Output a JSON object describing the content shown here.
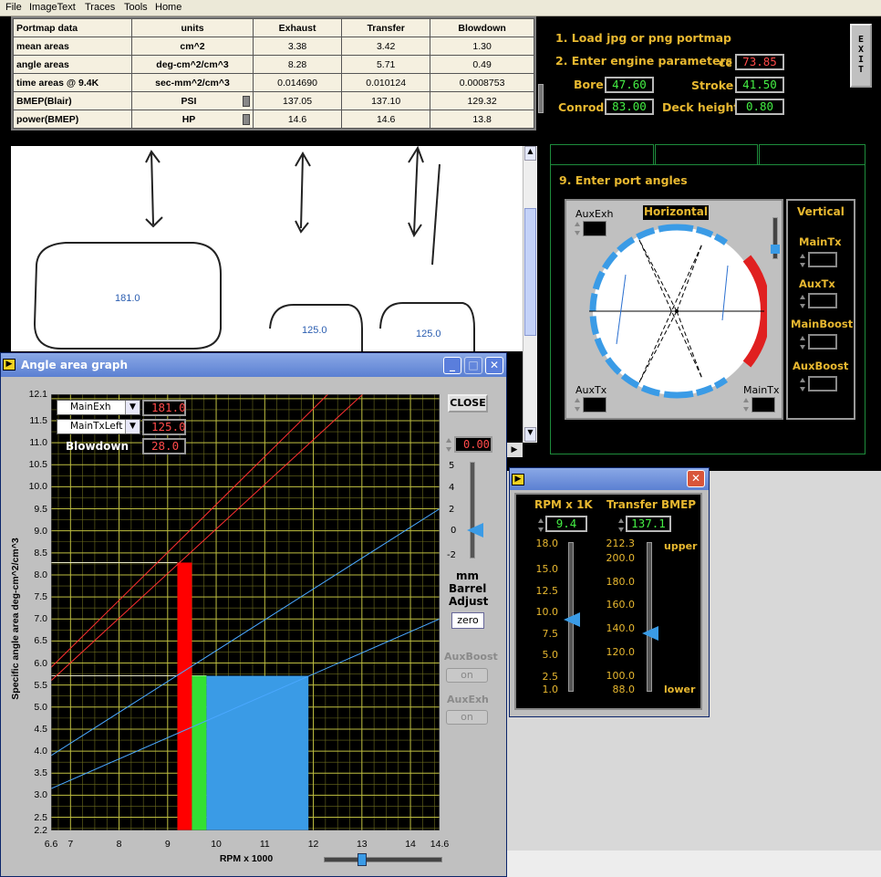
{
  "menu": [
    "File",
    "ImageText",
    "Traces",
    "Tools",
    "Home"
  ],
  "table": {
    "headers": [
      "Portmap data",
      "units",
      "Exhaust",
      "Transfer",
      "Blowdown"
    ],
    "rows": [
      [
        "mean areas",
        "cm^2",
        "3.38",
        "3.42",
        "1.30"
      ],
      [
        "angle areas",
        "deg-cm^2/cm^3",
        "8.28",
        "5.71",
        "0.49"
      ],
      [
        "time areas @ 9.4K",
        "sec-mm^2/cm^3",
        "0.014690",
        "0.010124",
        "0.0008753"
      ],
      [
        "BMEP(Blair)",
        "PSI",
        "137.05",
        "137.10",
        "129.32"
      ],
      [
        "power(BMEP)",
        "HP",
        "14.6",
        "14.6",
        "13.8"
      ]
    ]
  },
  "image_labels": [
    "181.0",
    "125.0",
    "125.0"
  ],
  "setup": {
    "step1": "1. Load jpg or png portmap",
    "step2": "2. Enter engine parameters",
    "cc_label": "cc",
    "cc": "73.85",
    "bore_label": "Bore",
    "bore": "47.60",
    "stroke_label": "Stroke",
    "stroke": "41.50",
    "conrod_label": "Conrod",
    "conrod": "83.00",
    "deck_label": "Deck height",
    "deck": "0.80",
    "exit": "EXIT",
    "step9": "9. Enter port angles"
  },
  "dial": {
    "horizontal": "Horizontal",
    "auxexh": "AuxExh",
    "auxtx": "AuxTx",
    "maintx": "MainTx"
  },
  "vertical": {
    "title": "Vertical",
    "items": [
      "MainTx",
      "AuxTx",
      "MainBoost",
      "AuxBoost"
    ]
  },
  "angle_window": {
    "title": "Angle area graph",
    "combo1": "MainExh",
    "combo1_val": "181.0",
    "combo2": "MainTxLeft",
    "combo2_val": "125.0",
    "blowdown_label": "Blowdown",
    "blowdown_val": "28.0",
    "close": "CLOSE",
    "barrel_val": "0.00",
    "barrel_ticks": [
      "5",
      "4",
      "2",
      "0",
      "-2"
    ],
    "barrel_label": [
      "mm",
      "Barrel",
      "Adjust"
    ],
    "zero": "zero",
    "auxboost": "AuxBoost",
    "auxexh": "AuxExh",
    "on": "on"
  },
  "chart_data": {
    "type": "area",
    "title": "",
    "xlabel": "RPM x 1000",
    "ylabel": "Specific angle area  deg-cm^2/cm^3",
    "xlim": [
      6.6,
      14.6
    ],
    "ylim": [
      2.2,
      12.1
    ],
    "xticks": [
      "6.6",
      "7",
      "8",
      "9",
      "10",
      "11",
      "12",
      "13",
      "14",
      "14.6"
    ],
    "yticks": [
      "12.1",
      "11.5",
      "11.0",
      "10.5",
      "10.0",
      "9.5",
      "9.0",
      "8.5",
      "8.0",
      "7.5",
      "7.0",
      "6.5",
      "6.0",
      "5.5",
      "5.0",
      "4.5",
      "4.0",
      "3.5",
      "3.0",
      "2.5",
      "2.2"
    ],
    "bars": [
      {
        "name": "exhaust",
        "x0": 9.2,
        "x1": 9.5,
        "y": 8.28,
        "color": "#ff0000"
      },
      {
        "name": "blowdown",
        "x0": 9.5,
        "x1": 9.8,
        "y": 5.71,
        "color": "#33e033"
      },
      {
        "name": "transfer",
        "x0": 9.8,
        "x1": 11.9,
        "y": 5.71,
        "color": "#3a9be6"
      }
    ],
    "lines": [
      {
        "color": "#ff3030",
        "x0": 6.6,
        "y0": 5.9,
        "x1": 14.6,
        "y1": 14.6
      },
      {
        "color": "#ff3030",
        "x0": 6.6,
        "y0": 5.6,
        "x1": 14.6,
        "y1": 13.7
      },
      {
        "color": "#4aa8ff",
        "x0": 6.6,
        "y0": 3.9,
        "x1": 14.6,
        "y1": 9.5
      },
      {
        "color": "#4aa8ff",
        "x0": 6.6,
        "y0": 3.15,
        "x1": 14.6,
        "y1": 7.0
      }
    ]
  },
  "rpm_window": {
    "rpm_label": "RPM x 1K",
    "rpm_val": "9.4",
    "bmep_label": "Transfer BMEP",
    "bmep_val": "137.1",
    "rpm_ticks": [
      "18.0",
      "15.0",
      "12.5",
      "10.0",
      "7.5",
      "5.0",
      "2.5",
      "1.0"
    ],
    "bmep_ticks": [
      "212.3",
      "200.0",
      "180.0",
      "160.0",
      "140.0",
      "120.0",
      "100.0",
      "88.0"
    ],
    "upper": "upper",
    "lower": "lower"
  }
}
